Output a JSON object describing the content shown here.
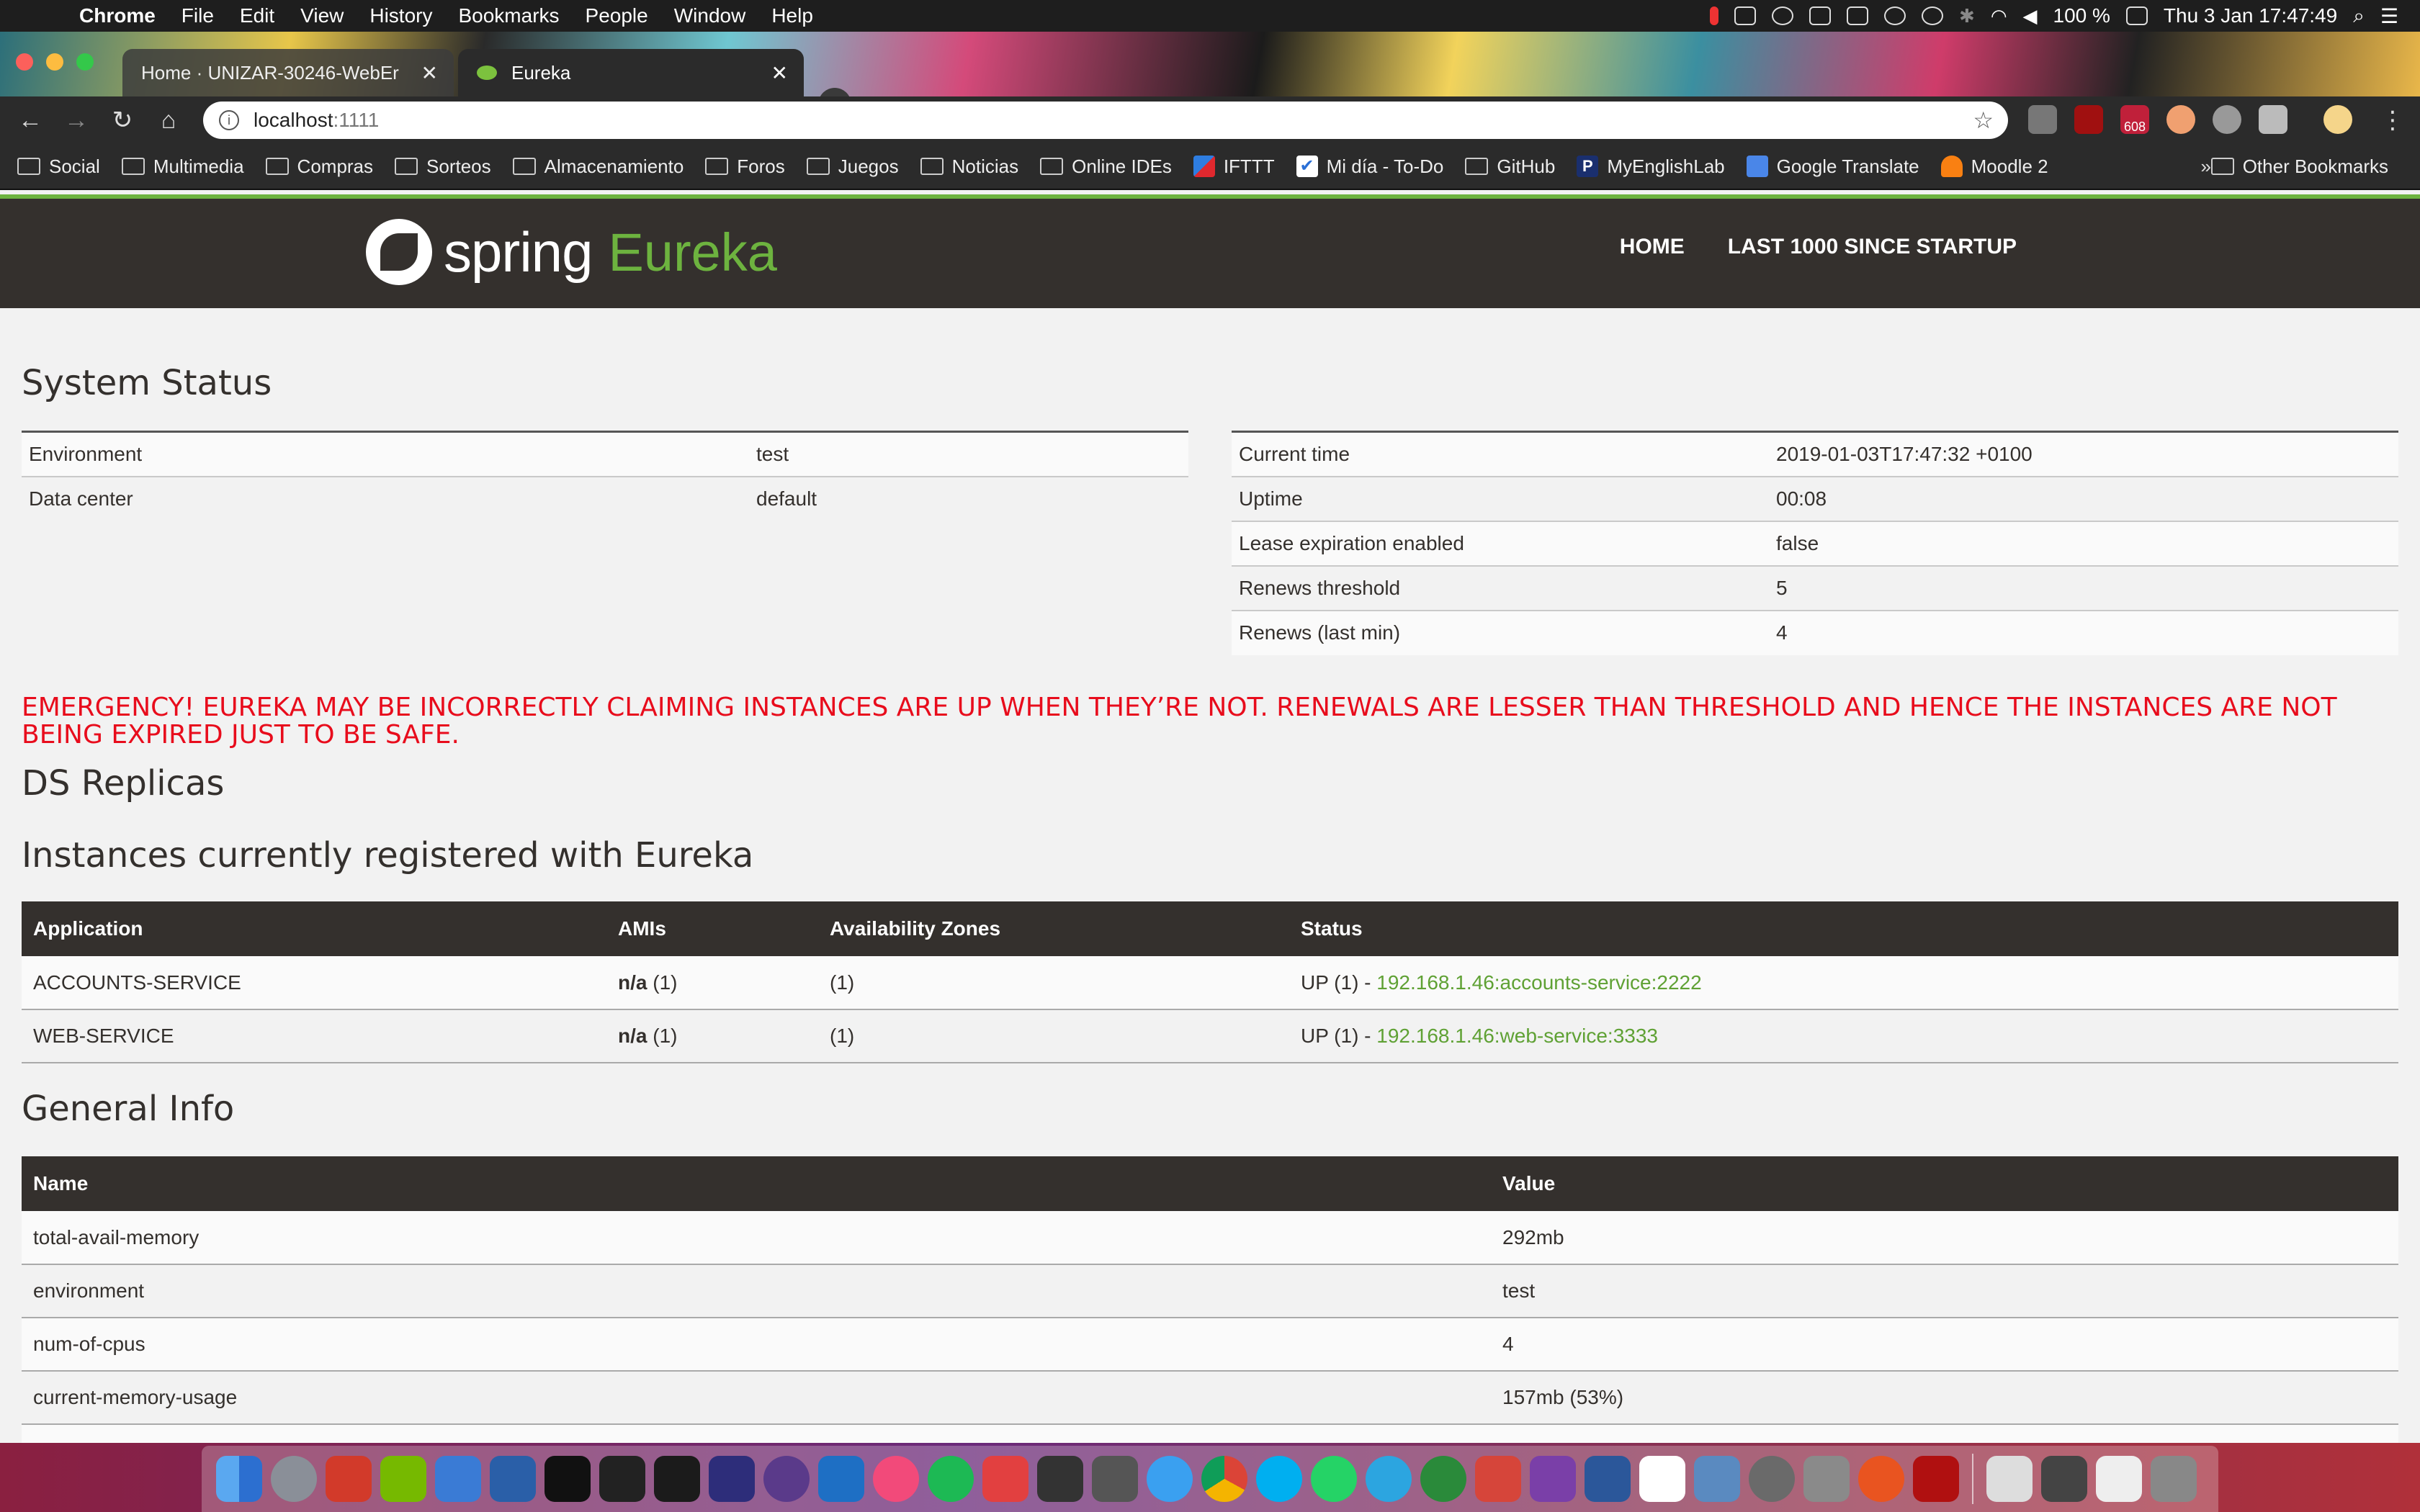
{
  "menubar": {
    "app": "Chrome",
    "items": [
      "File",
      "Edit",
      "View",
      "History",
      "Bookmarks",
      "People",
      "Window",
      "Help"
    ],
    "battery": "100 %",
    "clock": "Thu 3 Jan  17:47:49"
  },
  "tabs": [
    {
      "title": "Home · UNIZAR-30246-WebEr"
    },
    {
      "title": "Eureka"
    }
  ],
  "address": {
    "host": "localhost",
    "port": ":1111"
  },
  "ext_badge": "608",
  "bookmarks": {
    "items": [
      "Social",
      "Multimedia",
      "Compras",
      "Sorteos",
      "Almacenamiento",
      "Foros",
      "Juegos",
      "Noticias",
      "Online IDEs",
      "IFTTT",
      "Mi día - To-Do",
      "GitHub",
      "MyEnglishLab",
      "Google Translate",
      "Moodle 2"
    ],
    "overflow": "»",
    "other": "Other Bookmarks"
  },
  "brand": {
    "spring": "spring",
    "eureka": "Eureka"
  },
  "nav": {
    "home": "HOME",
    "last": "LAST 1000 SINCE STARTUP"
  },
  "system_status": {
    "title": "System Status",
    "left": [
      {
        "label": "Environment",
        "value": "test"
      },
      {
        "label": "Data center",
        "value": "default"
      }
    ],
    "right": [
      {
        "label": "Current time",
        "value": "2019-01-03T17:47:32 +0100"
      },
      {
        "label": "Uptime",
        "value": "00:08"
      },
      {
        "label": "Lease expiration enabled",
        "value": "false"
      },
      {
        "label": "Renews threshold",
        "value": "5"
      },
      {
        "label": "Renews (last min)",
        "value": "4"
      }
    ]
  },
  "emergency": "EMERGENCY! EUREKA MAY BE INCORRECTLY CLAIMING INSTANCES ARE UP WHEN THEY’RE NOT. RENEWALS ARE LESSER THAN THRESHOLD AND HENCE THE INSTANCES ARE NOT BEING EXPIRED JUST TO BE SAFE.",
  "ds_replicas": {
    "title": "DS Replicas"
  },
  "instances": {
    "title": "Instances currently registered with Eureka",
    "headers": [
      "Application",
      "AMIs",
      "Availability Zones",
      "Status"
    ],
    "rows": [
      {
        "app": "ACCOUNTS-SERVICE",
        "ami": "n/a",
        "ami_count": "(1)",
        "zones": "(1)",
        "status": "UP (1) - ",
        "link": "192.168.1.46:accounts-service:2222"
      },
      {
        "app": "WEB-SERVICE",
        "ami": "n/a",
        "ami_count": "(1)",
        "zones": "(1)",
        "status": "UP (1) - ",
        "link": "192.168.1.46:web-service:3333"
      }
    ]
  },
  "general_info": {
    "title": "General Info",
    "headers": [
      "Name",
      "Value"
    ],
    "rows": [
      {
        "name": "total-avail-memory",
        "value": "292mb"
      },
      {
        "name": "environment",
        "value": "test"
      },
      {
        "name": "num-of-cpus",
        "value": "4"
      },
      {
        "name": "current-memory-usage",
        "value": "157mb (53%)"
      }
    ]
  },
  "colors": {
    "spring_green": "#6db33f",
    "header_dark": "#34302d",
    "emergency_red": "#e80c1c",
    "link_green": "#5fa134"
  }
}
